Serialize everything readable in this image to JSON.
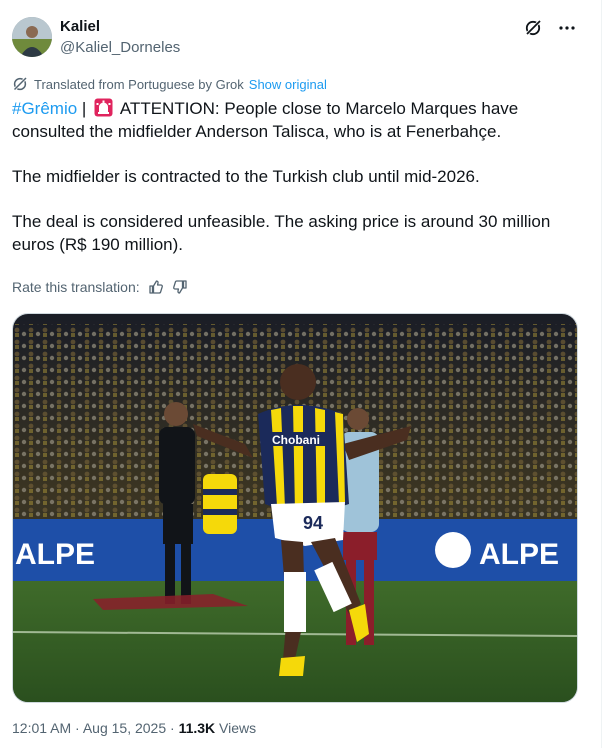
{
  "author": {
    "display_name": "Kaliel",
    "handle": "@Kaliel_Dorneles",
    "avatar_icon": "profile-photo"
  },
  "header_icons": [
    "grok-icon",
    "more-icon"
  ],
  "translation": {
    "notice": "Translated from Portuguese by Grok",
    "show_original": "Show original"
  },
  "tweet": {
    "hashtag": "#Grêmio",
    "separator": " |",
    "emoji_icon": "siren-icon",
    "line1_rest": "ATTENTION: People close to Marcelo Marques have consulted the midfielder Anderson Talisca, who is at Fenerbahçe.",
    "paragraph2": "The midfielder is contracted to the Turkish club until mid-2026.",
    "paragraph3": "The deal is considered unfeasible. The asking price is around 30 million euros (R$ 190 million)."
  },
  "rating": {
    "label": "Rate this translation:",
    "up_icon": "thumbs-up-icon",
    "down_icon": "thumbs-down-icon"
  },
  "media": {
    "description_icon": "photo",
    "jersey_sponsor": "Chobani",
    "jersey_number": "94",
    "board_text_left": "ALPE",
    "board_text_right": "ALPE"
  },
  "meta": {
    "time": "12:01 AM",
    "dot1": " · ",
    "date": "Aug 15, 2025",
    "dot2": " · ",
    "views_count": "11.3K",
    "views_label": " Views"
  },
  "colors": {
    "link": "#1d9bf0",
    "text": "#0f1419",
    "muted": "#536471",
    "jersey_navy": "#1b2a5a",
    "jersey_yellow": "#f5d90a",
    "board_blue": "#1e4fa8"
  }
}
